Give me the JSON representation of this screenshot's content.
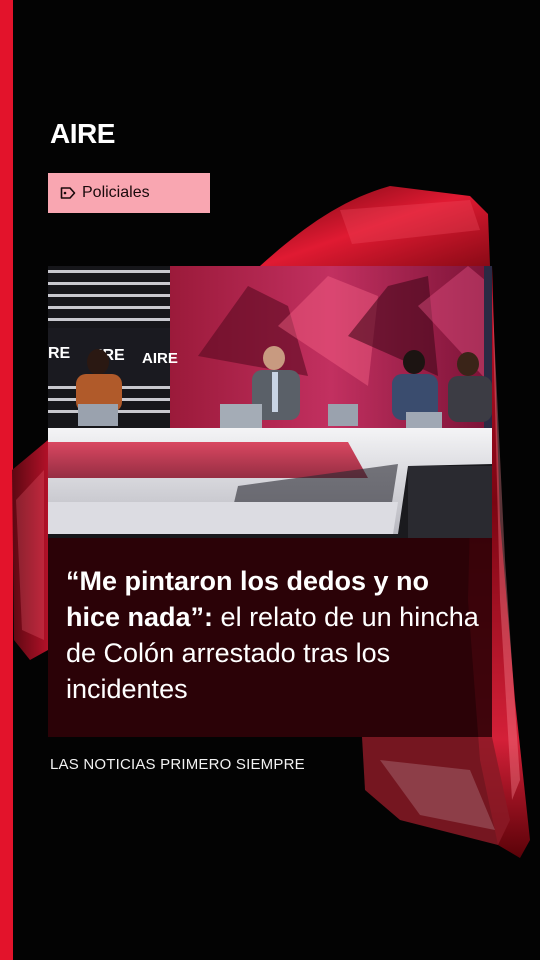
{
  "brand": {
    "name": "AIRE"
  },
  "category": {
    "label": "Policiales",
    "icon": "tag-icon"
  },
  "photo": {
    "description_icons": "news-studio-image",
    "studio_signs": [
      "RE",
      "IRE",
      "AIRE"
    ]
  },
  "headline": {
    "bold_part": "“Me pintaron los dedos y no hice nada”:",
    "regular_part": " el relato de un hincha de Colón arrestado tras los incidentes"
  },
  "tagline": "LAS NOTICIAS PRIMERO SIEMPRE",
  "colors": {
    "accent": "#e3132b",
    "category_bg": "#f9a6b1",
    "background": "#030303",
    "headline_box": "#300208"
  }
}
